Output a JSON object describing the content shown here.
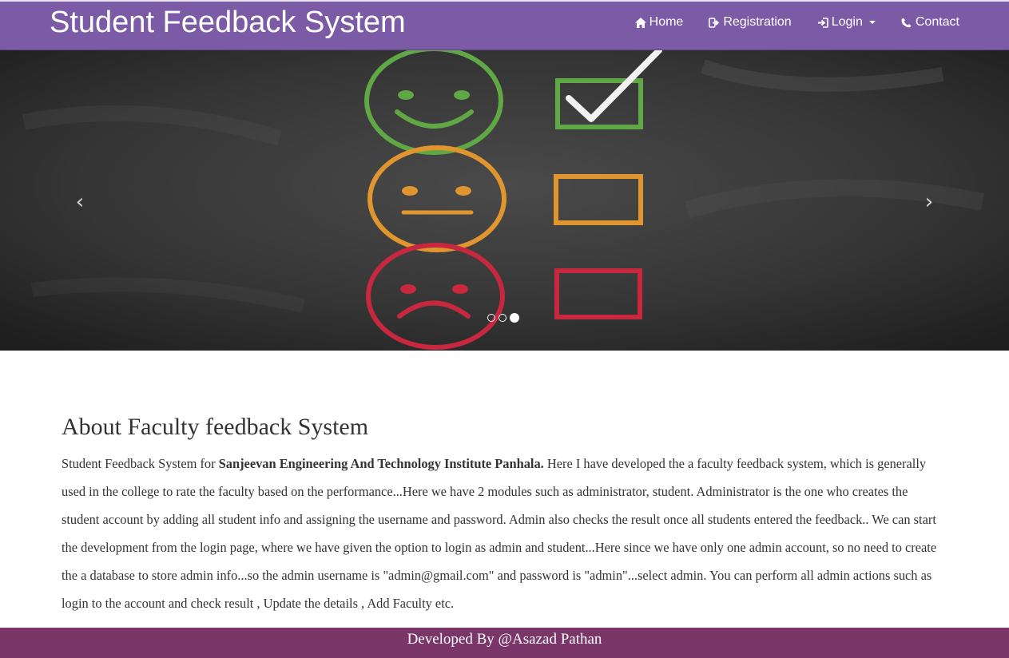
{
  "navbar": {
    "brand": "Student Feedback System",
    "items": [
      {
        "label": "Home",
        "icon": "home-icon"
      },
      {
        "label": "Registration",
        "icon": "sign-out-icon"
      },
      {
        "label": "Login",
        "icon": "sign-in-icon",
        "dropdown": true
      },
      {
        "label": "Contact",
        "icon": "phone-icon"
      }
    ],
    "color": "#7b5aa6"
  },
  "carousel": {
    "prev_label": "‹",
    "next_label": "›",
    "slide_count": 3,
    "active_slide": 3
  },
  "about": {
    "heading": "About Faculty feedback System",
    "text_intro": "Student Feedback System for ",
    "text_bold": "Sanjeevan Engineering And Technology Institute Panhala.",
    "text_rest": " Here I have developed the a faculty feedback system, which is generally used in the college to rate the faculty based on the performance...Here we have 2 modules such as administrator, student. Administrator is the one who creates the student account by adding all student info and assigning the username and password. Admin also checks the result once all students entered the feedback.. We can start the development from the login page, where we have given the option to login as admin and student...Here since we have only one admin account, so no need to create the a database to store admin info...so the admin username is \"admin@gmail.com\" and password is \"admin\"...select admin. You can perform all admin actions such as login to the account and check result , Update the details , Add Faculty etc."
  },
  "footer": {
    "text": "Developed By @Asazad Pathan",
    "color": "#7a3668"
  }
}
